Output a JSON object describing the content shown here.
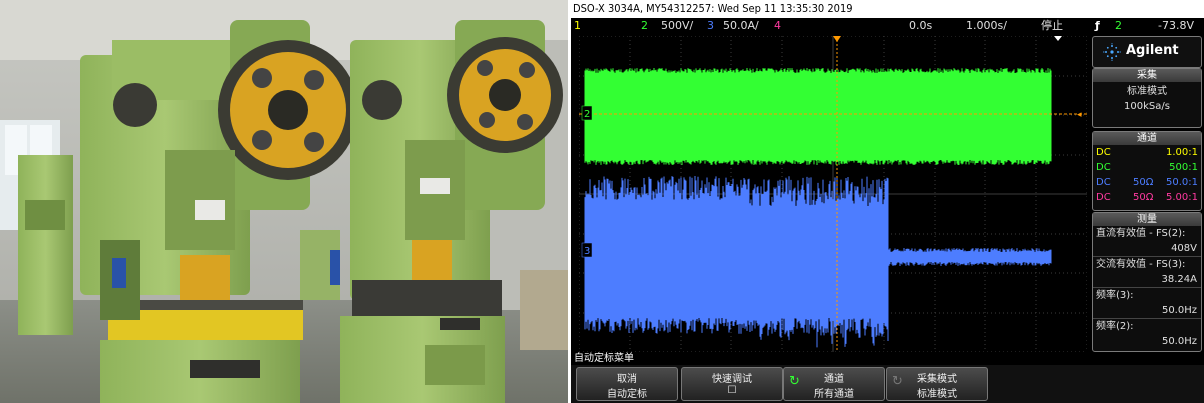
{
  "scope": {
    "header_title": "DSO-X 3034A, MY54312257: Wed Sep 11 13:35:30 2019",
    "status": {
      "ch1_num": "1",
      "ch2_num": "2",
      "ch2_scale": "500V/",
      "ch3_num": "3",
      "ch3_scale": "50.0A/",
      "ch4_num": "4",
      "time_delay": "0.0s",
      "time_scale": "1.000s/",
      "run_state": "停止",
      "trigger_symbol": "ƒ",
      "trigger_channel": "2",
      "trigger_level": "-73.8V"
    },
    "markers": {
      "ch2": "2",
      "ch3": "3"
    },
    "brand": "Agilent",
    "acquire": {
      "title": "采集",
      "mode": "标准模式",
      "rate": "100kSa/s"
    },
    "channels": {
      "title": "通道",
      "rows": [
        {
          "coupling": "DC",
          "impedance": "",
          "ratio": "1.00:1",
          "color": "#ffff00"
        },
        {
          "coupling": "DC",
          "impedance": "",
          "ratio": "500:1",
          "color": "#33ff33"
        },
        {
          "coupling": "DC",
          "impedance": "50Ω",
          "ratio": "50.0:1",
          "color": "#4d7dff"
        },
        {
          "coupling": "DC",
          "impedance": "50Ω",
          "ratio": "5.00:1",
          "color": "#ff3aa0"
        }
      ]
    },
    "measure": {
      "title": "测量",
      "items": [
        {
          "label": "直流有效值 - FS(2):",
          "value": "408V"
        },
        {
          "label": "交流有效值 - FS(3):",
          "value": "38.24A"
        },
        {
          "label": "频率(3):",
          "value": "50.0Hz"
        },
        {
          "label": "频率(2):",
          "value": "50.0Hz"
        }
      ]
    },
    "menu_title": "自动定标菜单",
    "softkeys": [
      {
        "line1": "取消",
        "line2": "自动定标"
      },
      {
        "line1": "快速调试",
        "line2": "☐"
      },
      {
        "line1": "通道",
        "line2": "所有通道"
      },
      {
        "line1": "采集模式",
        "line2": "标准模式"
      }
    ],
    "colors": {
      "ch1": "#ffff00",
      "ch2": "#33ff33",
      "ch3": "#4d7dff",
      "ch4": "#ff3aa0",
      "trigger_marker": "#ff9900"
    }
  }
}
